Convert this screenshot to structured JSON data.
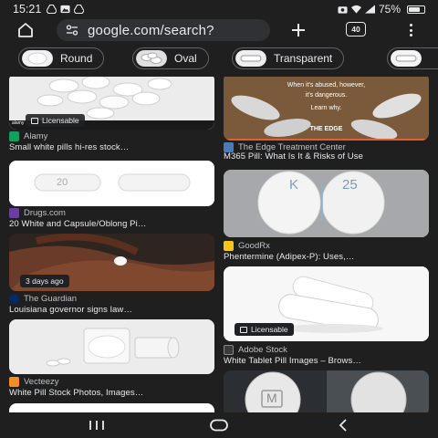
{
  "status_bar": {
    "time": "15:21",
    "battery_text": "75%",
    "battery_level": 0.75
  },
  "toolbar": {
    "url": "google.com/search?",
    "tab_count": "40"
  },
  "chips": [
    {
      "label": "Round"
    },
    {
      "label": "Oval"
    },
    {
      "label": "Transparent"
    },
    {
      "label": ""
    }
  ],
  "results": {
    "r1": {
      "source": "Alamy",
      "title": "Small white pills hi-res stock…",
      "badge": "Licensable",
      "corner_text": "alamy"
    },
    "r2": {
      "source": "The Edge Treatment Center",
      "title": "M365 Pill: What Is It & Risks of Use",
      "overlay_line1": "When it's abused, however,",
      "overlay_line2": "it's dangerous.",
      "overlay_line3": "Learn why.",
      "overlay_logo": "THE EDGE"
    },
    "r3": {
      "source": "Drugs.com",
      "title": "20 White and Capsule/Oblong Pi…",
      "imprint": "20"
    },
    "r4": {
      "source": "GoodRx",
      "title": "Phentermine (Adipex-P): Uses,…",
      "imprint_left": "K",
      "imprint_right": "25"
    },
    "r5": {
      "source": "The Guardian",
      "title": "Louisiana governor signs law…",
      "badge": "3 days ago"
    },
    "r6": {
      "source": "Adobe Stock",
      "title": "White Tablet Pill Images – Brows…",
      "badge": "Licensable"
    },
    "r7": {
      "source": "Vecteezy",
      "title": "White Pill Stock Photos, Images…"
    },
    "r8": {
      "imprint": "M"
    }
  },
  "colors": {
    "background": "#1f1f1f",
    "url_bar": "#303134",
    "text_primary": "#e8eaed",
    "text_secondary": "#bdc1c6"
  }
}
